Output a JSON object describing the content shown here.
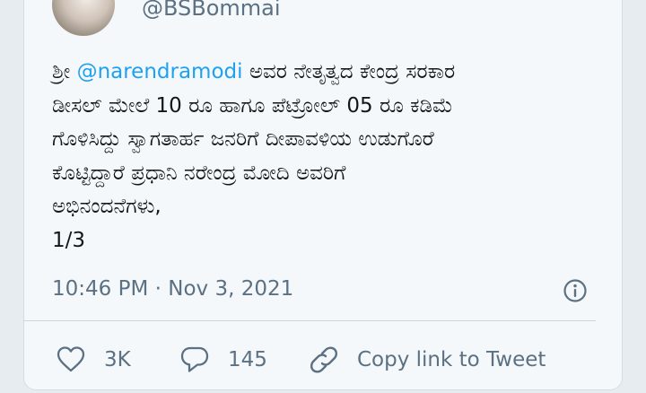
{
  "tweet": {
    "handle": "@BSBommai",
    "text_lines": [
      {
        "prefix": "ಶ್ರೀ ",
        "mention": "@narendramodi",
        "suffix": " ಅವರ ನೇತೃತ್ವದ ಕೇಂದ್ರ ಸರಕಾರ"
      },
      "ಡೀಸಲ್ ಮೇಲೆ 10 ರೂ ಹಾಗೂ ಪೆಟ್ರೋಲ್ 05 ರೂ ಕಡಿಮೆ",
      "ಗೊಳಿಸಿದ್ದು ಸ್ವಾಗತಾರ್ಹ ಜನರಿಗೆ ದೀಪಾವಳಿಯ ಉಡುಗೊರೆ",
      "ಕೊಟ್ಟಿದ್ದಾರೆ ಪ್ರಧಾನಿ ನರೇಂದ್ರ ಮೋದಿ ಅವರಿಗೆ",
      "ಅಭಿನಂದನೆಗಳು,",
      "1/3"
    ],
    "timestamp": "10:46 PM · Nov 3, 2021"
  },
  "actions": {
    "like": {
      "icon": "heart-icon",
      "count": "3K"
    },
    "reply": {
      "icon": "comment-icon",
      "count": "145"
    },
    "copy_link": {
      "icon": "link-icon",
      "label": "Copy link to Tweet"
    }
  },
  "info": {
    "icon": "info-icon"
  },
  "colors": {
    "background": "#e6ecf0",
    "card": "#f5f8fa",
    "text": "#14171a",
    "secondary": "#5b7083",
    "link": "#1da1f2"
  }
}
